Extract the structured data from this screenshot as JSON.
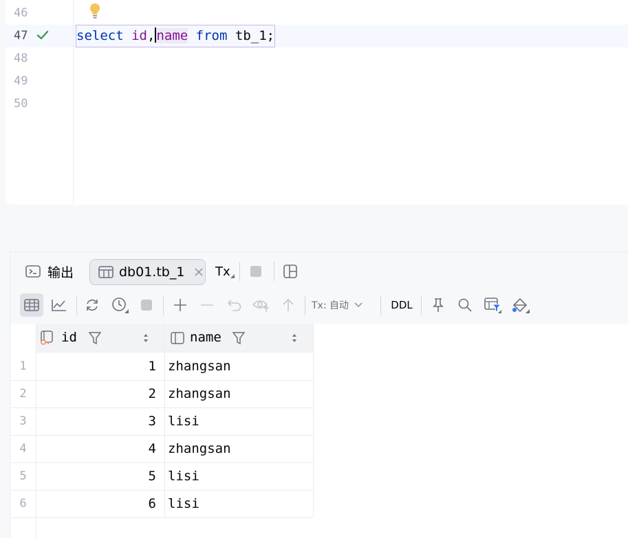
{
  "editor": {
    "line_numbers": [
      "46",
      "47",
      "48",
      "49",
      "50"
    ],
    "code": {
      "kw_select": "select",
      "col_id": "id",
      "comma": ",",
      "col_name": "name",
      "kw_from": "from",
      "table": "tb_1",
      "semicolon": ";"
    }
  },
  "tabs": {
    "output_label": "输出",
    "result_label": "db01.tb_1",
    "tx_label": "Tx"
  },
  "toolbar": {
    "tx_mode": "Tx: 自动",
    "ddl_label": "DDL"
  },
  "grid": {
    "columns": [
      "id",
      "name"
    ],
    "rows": [
      {
        "n": "1",
        "id": "1",
        "name": "zhangsan"
      },
      {
        "n": "2",
        "id": "2",
        "name": "zhangsan"
      },
      {
        "n": "3",
        "id": "3",
        "name": "lisi"
      },
      {
        "n": "4",
        "id": "4",
        "name": "zhangsan"
      },
      {
        "n": "5",
        "id": "5",
        "name": "lisi"
      },
      {
        "n": "6",
        "id": "6",
        "name": "lisi"
      }
    ]
  },
  "colors": {
    "keyword": "#0033b3",
    "identifier": "#871094",
    "success": "#3d9a50",
    "bulb": "#f2c55c"
  }
}
